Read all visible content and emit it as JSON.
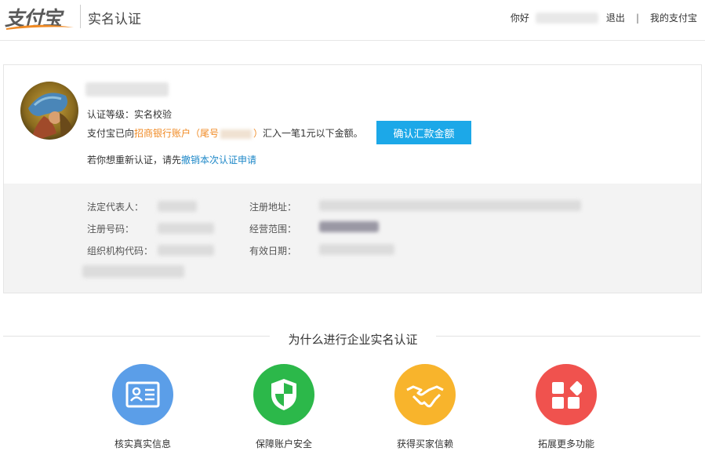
{
  "header": {
    "logo_text": "支付宝",
    "page_title": "实名认证",
    "greeting": "你好",
    "logout": "退出",
    "separator": "|",
    "my_alipay": "我的支付宝"
  },
  "card": {
    "cert_level": "认证等级：实名校验",
    "remit_prefix": "支付宝已向",
    "remit_bank": "招商银行账户（尾号",
    "remit_bank_close": "）",
    "remit_suffix": "汇入一笔1元以下金额。",
    "confirm_button": "确认汇款金额",
    "redo_prefix": "若你想重新认证，请先",
    "redo_link": "撤销本次认证申请"
  },
  "info": {
    "legal_rep": "法定代表人：",
    "reg_address": "注册地址：",
    "reg_number": "注册号码：",
    "business_scope": "经营范围：",
    "org_code": "组织机构代码：",
    "valid_date": "有效日期："
  },
  "why": {
    "title": "为什么进行企业实名认证",
    "features": [
      {
        "label": "核实真实信息",
        "icon": "id-card-icon",
        "color": "#5b9ee8"
      },
      {
        "label": "保障账户安全",
        "icon": "shield-icon",
        "color": "#2cb84a"
      },
      {
        "label": "获得买家信赖",
        "icon": "handshake-icon",
        "color": "#f8b42c"
      },
      {
        "label": "拓展更多功能",
        "icon": "apps-icon",
        "color": "#f0524e"
      }
    ]
  },
  "colors": {
    "accent_blue": "#1ca8e8",
    "link_blue": "#1e88c8",
    "bank_orange": "#f08a24",
    "panel_gray": "#f3f3f3"
  }
}
